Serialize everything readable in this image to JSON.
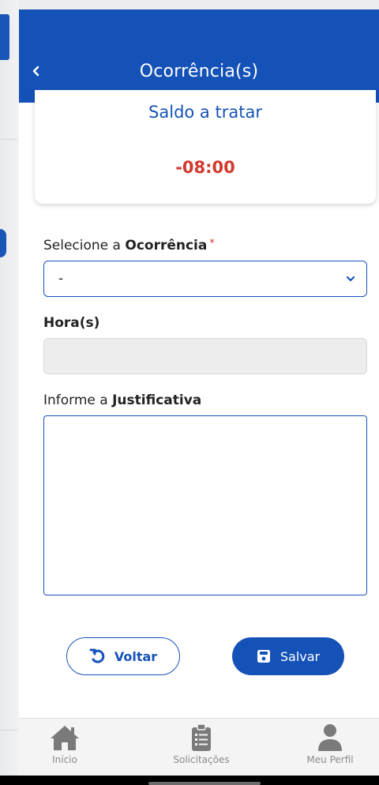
{
  "header": {
    "title": "Ocorrência(s)"
  },
  "balance": {
    "label": "Saldo a tratar",
    "value": "-08:00"
  },
  "form": {
    "occurrence_label_prefix": "Selecione a ",
    "occurrence_label_bold": "Ocorrência",
    "occurrence_required_mark": "*",
    "occurrence_selected": "-",
    "hours_label": "Hora(s)",
    "hours_value": "",
    "justification_label_prefix": "Informe a ",
    "justification_label_bold": "Justificativa",
    "justification_value": ""
  },
  "actions": {
    "back_label": "Voltar",
    "save_label": "Salvar"
  },
  "nav": {
    "items": [
      {
        "label": "Início",
        "icon": "home-icon"
      },
      {
        "label": "Solicitações",
        "icon": "clipboard-list-icon"
      },
      {
        "label": "Meu Perfil",
        "icon": "user-icon"
      }
    ]
  },
  "colors": {
    "primary": "#1552b8",
    "negative": "#d2392e",
    "nav_icon": "#7a7a7a"
  }
}
